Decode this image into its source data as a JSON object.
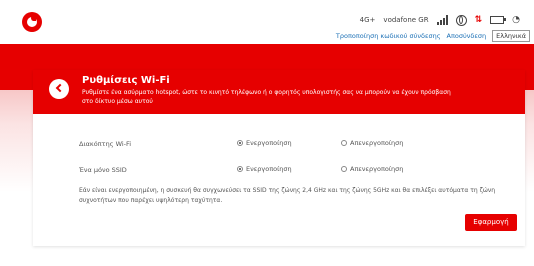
{
  "status": {
    "network": "4G+",
    "operator": "vodafone GR"
  },
  "header_links": {
    "change_login": "Τροποποίηση κωδικού σύνδεσης",
    "logout": "Αποσύνδεση",
    "language": "Ελληνικά"
  },
  "page": {
    "title": "Ρυθμίσεις Wi-Fi",
    "subtitle": "Ρυθμίστε ένα ασύρματο hotspot, ώστε το κινητό τηλέφωνο ή ο φορητός υπολογιστής σας να μπορούν να έχουν πρόσβαση στο δίκτυο μέσω αυτού"
  },
  "settings": [
    {
      "label": "Διακόπτης Wi-Fi",
      "options": [
        "Ενεργοποίηση",
        "Απενεργοποίηση"
      ],
      "selected": "Ενεργοποίηση"
    },
    {
      "label": "Ένα μόνο SSID",
      "options": [
        "Ενεργοποίηση",
        "Απενεργοποίηση"
      ],
      "selected": "Ενεργοποίηση"
    }
  ],
  "note": "Εάν είναι ενεργοποιημένη, η συσκευή θα συγχωνεύσει τα SSID της ζώνης 2,4 GHz και της ζώνης 5GHz και θα επιλέξει αυτόματα τη ζώνη συχνοτήτων που παρέχει υψηλότερη ταχύτητα.",
  "apply_label": "Εφαρμογή",
  "colors": {
    "brand": "#e60000",
    "link": "#1a6fb5"
  }
}
